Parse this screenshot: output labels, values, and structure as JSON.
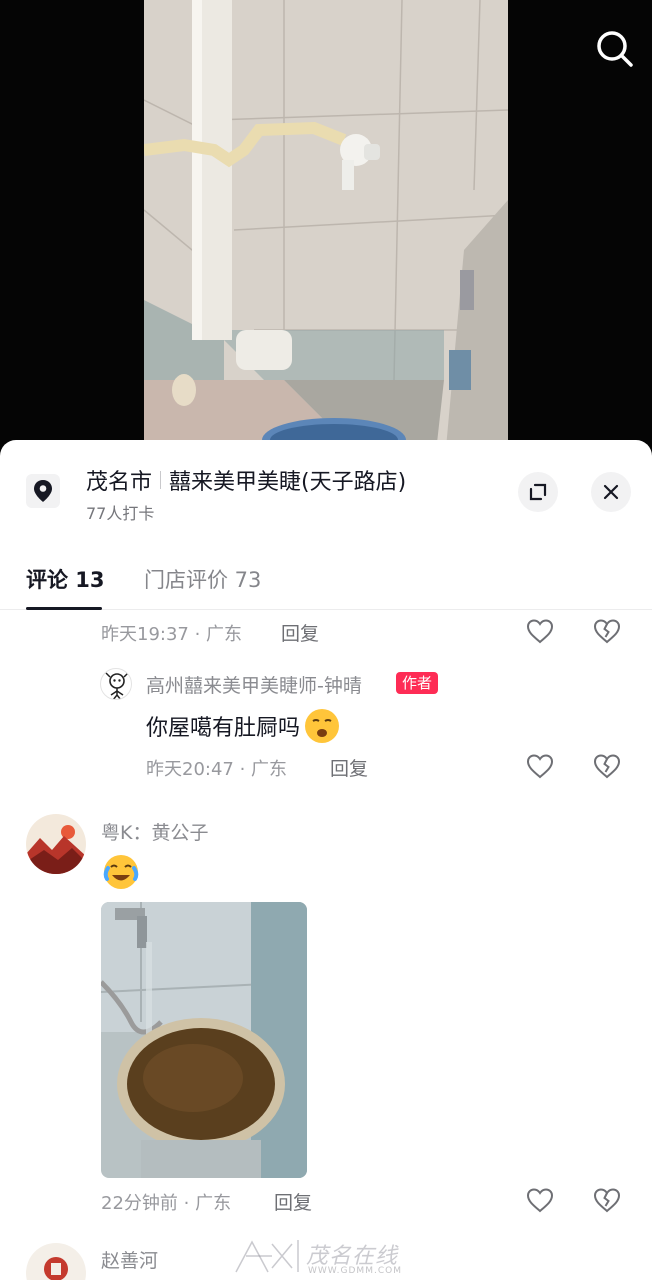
{
  "video": {
    "description_icon": "search-icon"
  },
  "panel": {
    "city": "茂名市",
    "store_name": "囍来美甲美睫(天子路店)",
    "checkins": "77人打卡"
  },
  "tabs": [
    {
      "label": "评论 13"
    },
    {
      "label": "门店评价 73"
    }
  ],
  "comments": [
    {
      "meta": "昨天19:37 · 广东",
      "reply": "回复"
    },
    {
      "username": "高州囍来美甲美睫师-钟晴",
      "badge": "作者",
      "text": "你屋噶有肚屙吗",
      "meta": "昨天20:47 · 广东",
      "reply": "回复"
    },
    {
      "username": "粤K：黄公子",
      "text": "",
      "meta": "22分钟前 · 广东",
      "reply": "回复"
    },
    {
      "username": "赵善河"
    }
  ],
  "watermark": {
    "brand": "茂名在线",
    "url": "WWW.GDMM.COM"
  },
  "colors": {
    "accent": "#fe2c55",
    "text": "#161823",
    "muted": "#98999e"
  }
}
